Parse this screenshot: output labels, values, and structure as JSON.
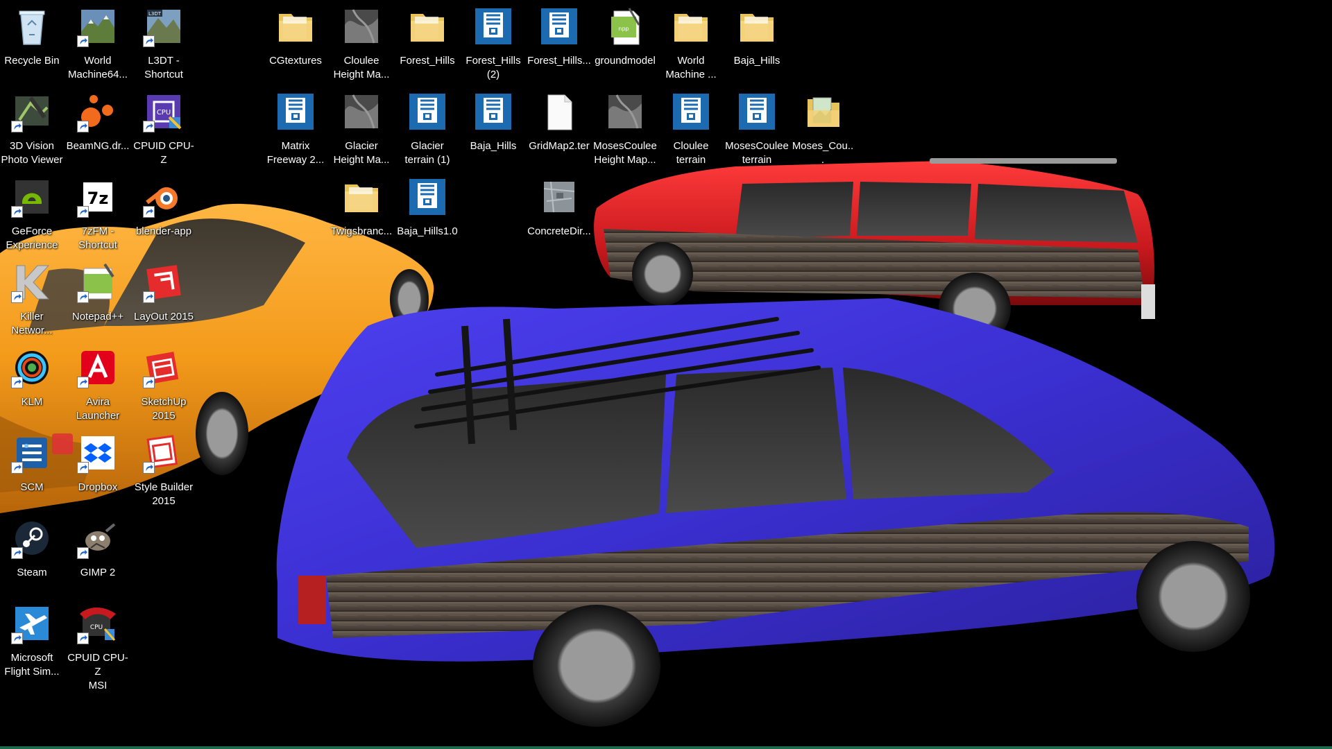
{
  "desktop": {
    "icons": [
      {
        "label": "Recycle Bin",
        "icon": "recycle-bin-icon",
        "shortcut": false
      },
      {
        "label": "World\nMachine64...",
        "icon": "world-machine-icon",
        "shortcut": true
      },
      {
        "label": "L3DT -\nShortcut",
        "icon": "l3dt-icon",
        "shortcut": true
      },
      {
        "label": "CGtextures",
        "icon": "folder-icon",
        "shortcut": false
      },
      {
        "label": "Cloulee\nHeight Ma...",
        "icon": "heightmap-image-icon",
        "shortcut": false
      },
      {
        "label": "Forest_Hills",
        "icon": "folder-icon",
        "shortcut": false
      },
      {
        "label": "Forest_Hills\n(2)",
        "icon": "zip-archive-icon",
        "shortcut": false
      },
      {
        "label": "Forest_Hills...",
        "icon": "zip-archive-icon",
        "shortcut": false
      },
      {
        "label": "groundmodel",
        "icon": "notepadpp-file-icon",
        "shortcut": false
      },
      {
        "label": "World\nMachine ...",
        "icon": "folder-icon",
        "shortcut": false
      },
      {
        "label": "Baja_Hills",
        "icon": "folder-icon",
        "shortcut": false
      },
      {
        "label": "3D Vision\nPhoto Viewer",
        "icon": "3d-vision-icon",
        "shortcut": true
      },
      {
        "label": "BeamNG.dr...",
        "icon": "beamng-icon",
        "shortcut": true
      },
      {
        "label": "CPUID CPU-Z",
        "icon": "cpu-z-icon",
        "shortcut": true
      },
      {
        "label": "Matrix\nFreeway 2...",
        "icon": "zip-archive-icon",
        "shortcut": false
      },
      {
        "label": "Glacier\nHeight Ma...",
        "icon": "heightmap-image-icon",
        "shortcut": false
      },
      {
        "label": "Glacier\nterrain (1)",
        "icon": "zip-archive-icon",
        "shortcut": false
      },
      {
        "label": "Baja_Hills",
        "icon": "zip-archive-icon",
        "shortcut": false
      },
      {
        "label": "GridMap2.ter",
        "icon": "blank-file-icon",
        "shortcut": false
      },
      {
        "label": "MosesCoulee\nHeight Map...",
        "icon": "heightmap-image-icon",
        "shortcut": false
      },
      {
        "label": "Cloulee\nterrain",
        "icon": "zip-archive-icon",
        "shortcut": false
      },
      {
        "label": "MosesCoulee\nterrain",
        "icon": "zip-archive-icon",
        "shortcut": false
      },
      {
        "label": "Moses_Cou...",
        "icon": "image-folder-icon",
        "shortcut": false
      },
      {
        "label": "GeForce\nExperience",
        "icon": "geforce-icon",
        "shortcut": true
      },
      {
        "label": "7zFM -\nShortcut",
        "icon": "7zip-icon",
        "shortcut": true
      },
      {
        "label": "blender-app",
        "icon": "blender-icon",
        "shortcut": true
      },
      {
        "label": "Twigsbranc...",
        "icon": "folder-icon",
        "shortcut": false
      },
      {
        "label": "Baja_Hills1.0",
        "icon": "zip-archive-icon",
        "shortcut": false
      },
      {
        "label": "ConcreteDir...",
        "icon": "concrete-texture-icon",
        "shortcut": false
      },
      {
        "label": "Killer\nNetwor...",
        "icon": "killer-network-icon",
        "shortcut": true
      },
      {
        "label": "Notepad++",
        "icon": "notepadpp-icon",
        "shortcut": true
      },
      {
        "label": "LayOut 2015",
        "icon": "layout-icon",
        "shortcut": true
      },
      {
        "label": "KLM",
        "icon": "klm-icon",
        "shortcut": true
      },
      {
        "label": "Avira\nLauncher",
        "icon": "avira-icon",
        "shortcut": true
      },
      {
        "label": "SketchUp\n2015",
        "icon": "sketchup-icon",
        "shortcut": true
      },
      {
        "label": "SCM",
        "icon": "scm-icon",
        "shortcut": true
      },
      {
        "label": "Dropbox",
        "icon": "dropbox-icon",
        "shortcut": true
      },
      {
        "label": "Style Builder\n2015",
        "icon": "style-builder-icon",
        "shortcut": true
      },
      {
        "label": "Steam",
        "icon": "steam-icon",
        "shortcut": true
      },
      {
        "label": "GIMP 2",
        "icon": "gimp-icon",
        "shortcut": true
      },
      {
        "label": "Microsoft\nFlight Sim...",
        "icon": "flight-sim-icon",
        "shortcut": true
      },
      {
        "label": "CPUID CPU-Z\nMSI",
        "icon": "cpu-z-msi-icon",
        "shortcut": true
      }
    ]
  },
  "wallpaper": {
    "cars": [
      {
        "name": "orange-sedan",
        "body_color": "#f39a1a"
      },
      {
        "name": "red-station-wagon",
        "body_color": "#c8191e"
      },
      {
        "name": "purple-station-wagon",
        "body_color": "#3a2fd0"
      }
    ]
  }
}
